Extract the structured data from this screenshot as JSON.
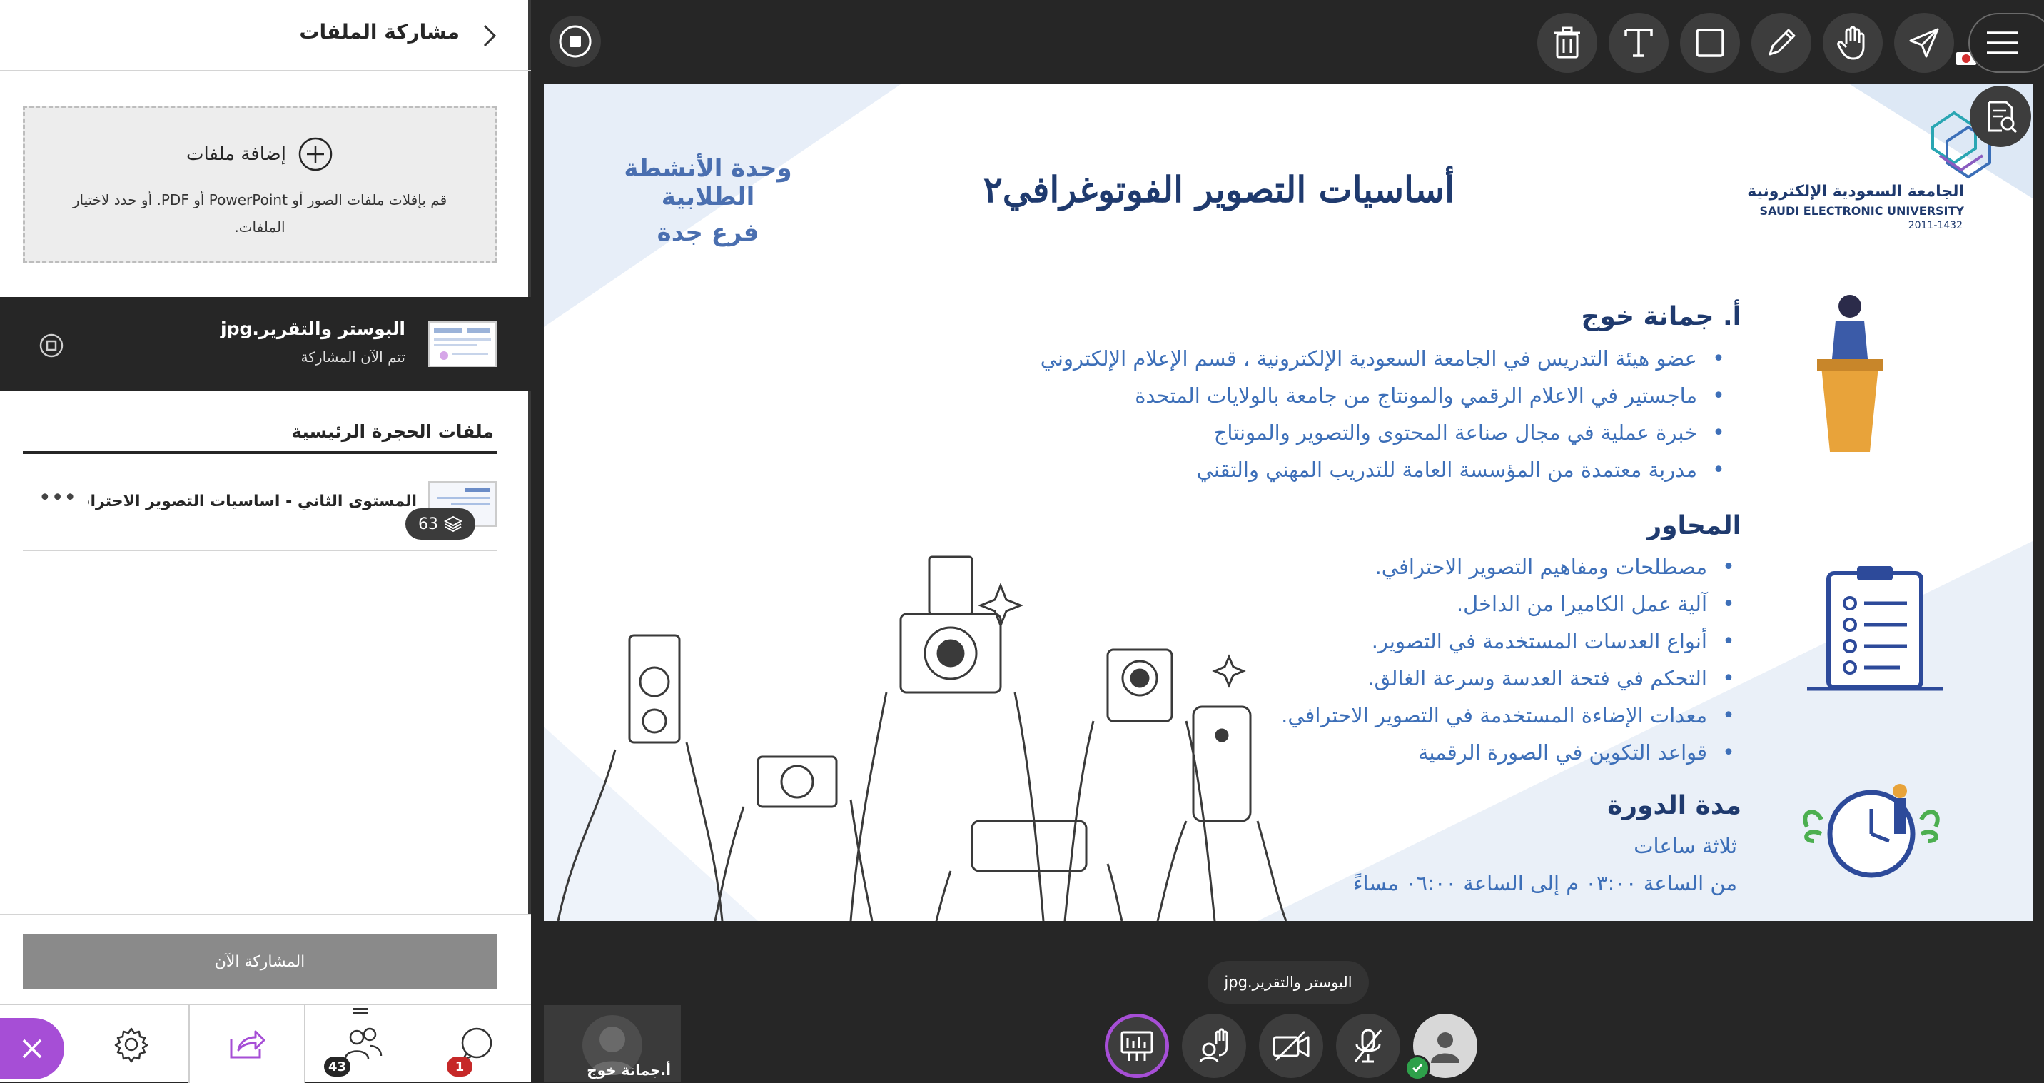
{
  "panel": {
    "title": "مشاركة الملفات",
    "add_files_title": "إضافة ملفات",
    "add_files_desc": "قم بإفلات ملفات الصور أو PowerPoint أو PDF. أو حدد لاختيار الملفات.",
    "current_share": {
      "file_name": "البوستر والتقرير.jpg",
      "status": "تتم الآن المشاركة"
    },
    "room_files_heading": "ملفات الحجرة الرئيسية",
    "room_file": {
      "name": "المستوى الثاني - اساسيات التصوير الاحترافي.x...",
      "slide_count": "63"
    },
    "share_now_button": "المشاركة الآن"
  },
  "nav": {
    "attendees_count": "43",
    "chat_count": "1"
  },
  "slide": {
    "title": "أساسيات التصوير الفوتوغرافي٢",
    "unit_line1": "وحدة الأنشطة الطلابية",
    "unit_line2": "فرع جدة",
    "university_ar": "الجامعة السعودية الإلكترونية",
    "university_en": "SAUDI ELECTRONIC UNIVERSITY",
    "university_years": "2011-1432",
    "instructor_heading": "أ. جمانة خوج",
    "instructor_bullets": [
      "عضو هيئة التدريس في الجامعة السعودية الإلكترونية ، قسم الإعلام الإلكتروني",
      "ماجستير في الاعلام الرقمي والمونتاج من جامعة بالولايات المتحدة",
      "خبرة عملية في مجال صناعة المحتوى والتصوير والمونتاج",
      "مدربة معتمدة من المؤسسة العامة للتدريب المهني والتقني"
    ],
    "topics_heading": "المحاور",
    "topics_bullets": [
      "مصطلحات ومفاهيم التصوير الاحترافي.",
      "آلية عمل الكاميرا من الداخل.",
      "أنواع العدسات المستخدمة في التصوير.",
      "التحكم في فتحة العدسة وسرعة الغالق.",
      "معدات الإضاءة المستخدمة في التصوير الاحترافي.",
      "قواعد التكوين في الصورة الرقمية"
    ],
    "duration_heading": "مدة الدورة",
    "duration_line1": "ثلاثة ساعات",
    "duration_line2": "من الساعة ٠٣:٠٠ م إلى الساعة ٠٦:٠٠ مساءً"
  },
  "stage": {
    "tooltip_filename": "البوستر والتقرير.jpg",
    "video_name": "أ.جمانة خوج"
  },
  "colors": {
    "accent": "#a64ed6",
    "slide_heading": "#1f3a6e",
    "slide_text": "#3d6fb8",
    "badge_red": "#c62828",
    "status_green": "#2ea04a"
  }
}
